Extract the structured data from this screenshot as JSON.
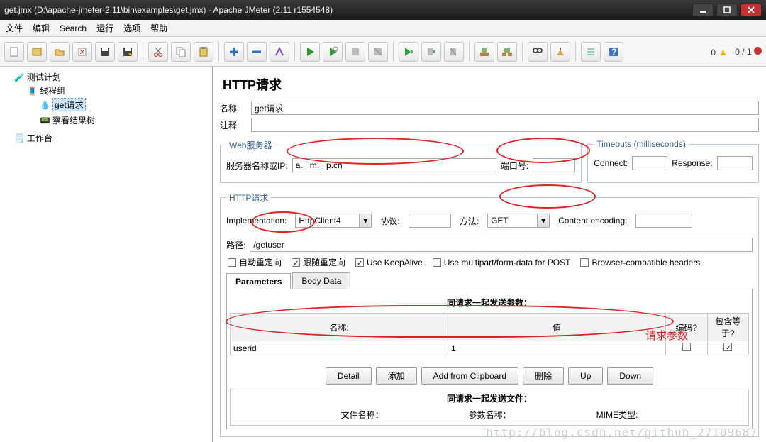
{
  "window": {
    "title": "get.jmx (D:\\apache-jmeter-2.11\\bin\\examples\\get.jmx) - Apache JMeter (2.11 r1554548)"
  },
  "menu": {
    "items": [
      "文件",
      "编辑",
      "Search",
      "运行",
      "选项",
      "帮助"
    ]
  },
  "status": {
    "warn": "0",
    "err": "0 / 1"
  },
  "tree": {
    "root": "测试计划",
    "group": "线程组",
    "req": "get请求",
    "listener": "察看结果树",
    "workbench": "工作台"
  },
  "form": {
    "heading": "HTTP请求",
    "name_lbl": "名称:",
    "name_val": "get请求",
    "comment_lbl": "注释:",
    "comment_val": "",
    "web_legend": "Web服务器",
    "server_lbl": "服务器名称或IP:",
    "server_val": "a.   m.   p.cn",
    "port_lbl": "端口号:",
    "port_val": "",
    "timeouts_legend": "Timeouts (milliseconds)",
    "connect_lbl": "Connect:",
    "connect_val": "",
    "response_lbl": "Response:",
    "response_val": "",
    "http_legend": "HTTP请求",
    "impl_lbl": "Implementation:",
    "impl_val": "HttpClient4",
    "proto_lbl": "协议:",
    "proto_val": "",
    "method_lbl": "方法:",
    "method_val": "GET",
    "enc_lbl": "Content encoding:",
    "enc_val": "",
    "path_lbl": "路径:",
    "path_val": "/getuser",
    "chk_autoredir": "自动重定向",
    "chk_followredir": "跟随重定向",
    "chk_keepalive": "Use KeepAlive",
    "chk_multipart": "Use multipart/form-data for POST",
    "chk_browserhdr": "Browser-compatible headers",
    "tab_params": "Parameters",
    "tab_body": "Body Data",
    "params_title": "同请求一起发送参数：",
    "col_name": "名称:",
    "col_value": "值",
    "col_encode": "编码?",
    "col_include": "包含等于?",
    "row1_name": "userid",
    "row1_value": "1",
    "btn_detail": "Detail",
    "btn_add": "添加",
    "btn_clip": "Add from Clipboard",
    "btn_del": "删除",
    "btn_up": "Up",
    "btn_down": "Down",
    "files_title": "同请求一起发送文件：",
    "files_col1": "文件名称：",
    "files_col2": "参数名称：",
    "files_col3": "MIME类型:"
  },
  "annotation": "请求参数",
  "watermark": "http://blog.csdn.net/github_27109687"
}
